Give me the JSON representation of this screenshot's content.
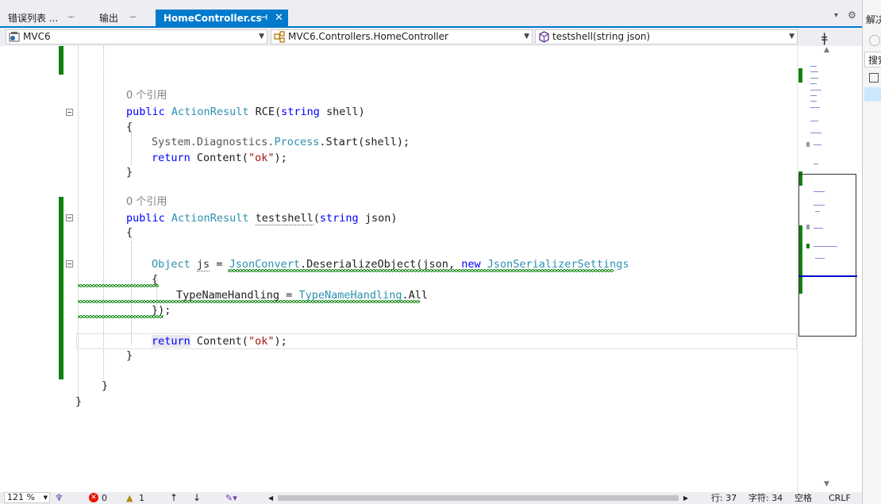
{
  "tabs": [
    {
      "label": "错误列表 ...",
      "pin": "ᅮ",
      "active": false
    },
    {
      "label": "输出",
      "pin": "ᅮ",
      "active": false
    },
    {
      "label": "HomeController.cs",
      "pin": "⊣",
      "close": "✕",
      "active": true
    }
  ],
  "tab_menu": {
    "dropdown": "▾",
    "gear": "⚙"
  },
  "navbar": {
    "project": "MVC6",
    "class": "MVC6.Controllers.HomeController",
    "member": "testshell(string json)",
    "split": "ǂ"
  },
  "code": {
    "ref1": "0 个引用",
    "ref2": "0 个引用",
    "l_rce_public": "public",
    "l_rce_type": "ActionResult",
    "l_rce_name": " RCE(",
    "l_rce_string": "string",
    "l_rce_param": " shell)",
    "l_brace_open": "{",
    "l_sys": "System.Diagnostics.",
    "l_process": "Process",
    "l_start": ".Start(shell);",
    "l_return": "return",
    "l_content": " Content(",
    "l_ok": "\"ok\"",
    "l_end": ");",
    "l_brace_close": "}",
    "l_ts_public": "public",
    "l_ts_type": "ActionResult",
    "l_ts_name": "testshell",
    "l_ts_paren": "(",
    "l_ts_string": "string",
    "l_ts_param": " json)",
    "l_obj": "Object",
    "l_js": "js",
    "l_eq": " = ",
    "l_jc": "JsonConvert",
    "l_deser": ".DeserializeObject(json, ",
    "l_new": "new",
    "l_settings": "JsonSerializerSettings",
    "l_tnh": "TypeNameHandling = ",
    "l_tnh_type": "TypeNameHandling",
    "l_all": ".All",
    "l_close_paren": "});",
    "l_return2": "return",
    "l_content2": " Content(",
    "l_ok2": "\"ok\"",
    "l_end2": ");"
  },
  "right_panel": {
    "title": "解决",
    "search": "搜索"
  },
  "status": {
    "zoom": "121 %",
    "errors": "0",
    "warnings": "1",
    "line": "行: 37",
    "char": "字符: 34",
    "space": "空格",
    "eol": "CRLF"
  },
  "colors": {
    "accent": "#007acc",
    "changed": "#108010",
    "error": "#e51400",
    "warning": "#f0c000"
  }
}
